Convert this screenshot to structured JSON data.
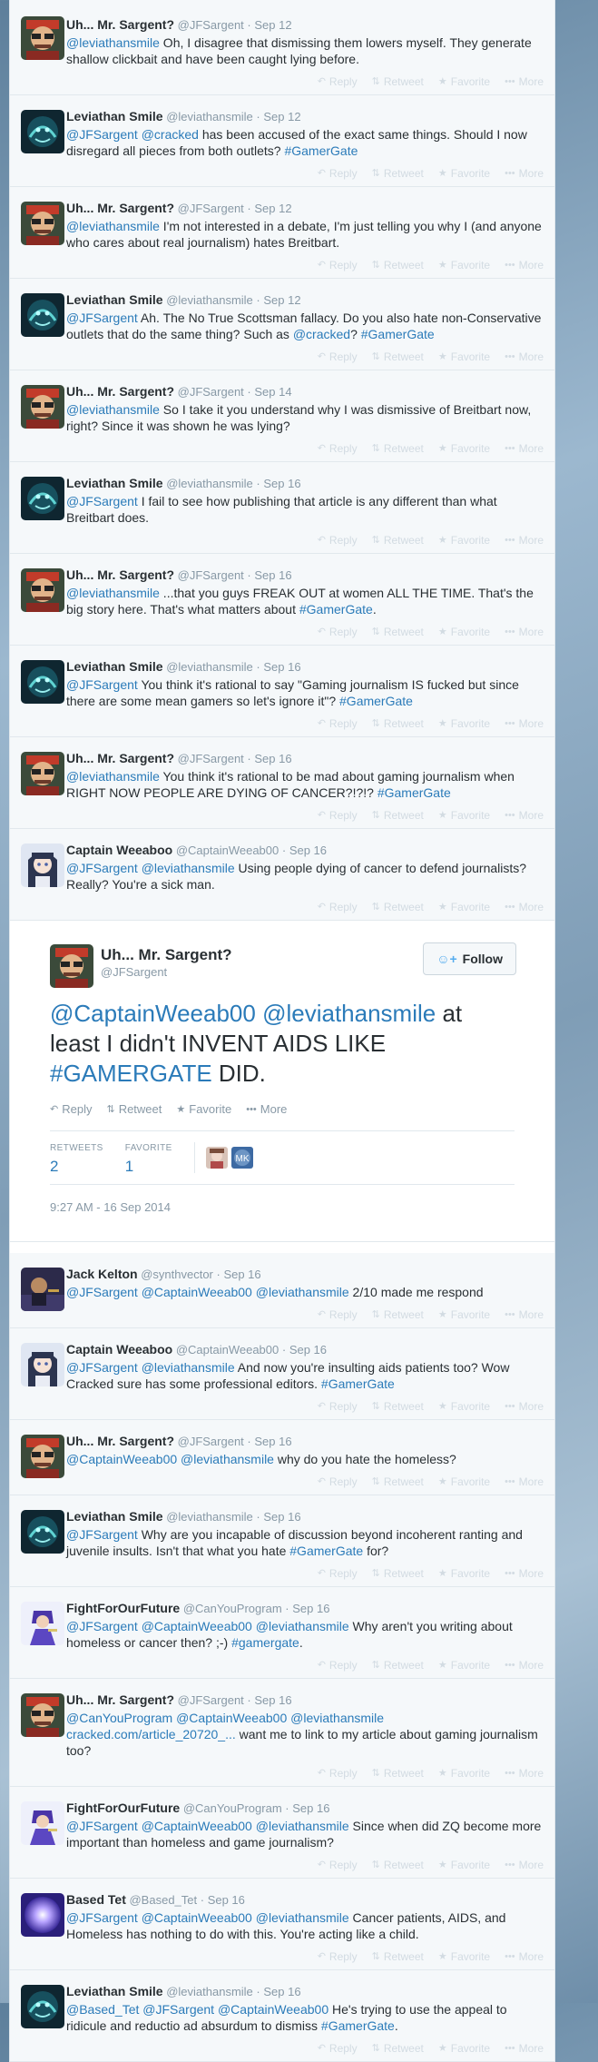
{
  "tweets_before": [
    {
      "name": "Uh... Mr. Sargent?",
      "handle": "@JFSargent",
      "time": "Sep 12",
      "avatar": "sargent",
      "segments": [
        [
          "a",
          "@leviathansmile"
        ],
        [
          "t",
          " Oh, I disagree that dismissing them lowers myself. They generate shallow clickbait and have been caught lying before."
        ]
      ]
    },
    {
      "name": "Leviathan Smile",
      "handle": "@leviathansmile",
      "time": "Sep 12",
      "avatar": "leviathan",
      "segments": [
        [
          "a",
          "@JFSargent"
        ],
        [
          "t",
          " "
        ],
        [
          "a",
          "@cracked"
        ],
        [
          "t",
          " has been accused of the exact same things. Should I now disregard all pieces from both outlets? "
        ],
        [
          "g",
          "#GamerGate"
        ]
      ]
    },
    {
      "name": "Uh... Mr. Sargent?",
      "handle": "@JFSargent",
      "time": "Sep 12",
      "avatar": "sargent",
      "segments": [
        [
          "a",
          "@leviathansmile"
        ],
        [
          "t",
          " I'm not interested in a debate, I'm just telling you why I (and anyone who cares about real journalism) hates Breitbart."
        ]
      ]
    },
    {
      "name": "Leviathan Smile",
      "handle": "@leviathansmile",
      "time": "Sep 12",
      "avatar": "leviathan",
      "segments": [
        [
          "a",
          "@JFSargent"
        ],
        [
          "t",
          " Ah. The No True Scottsman fallacy. Do you also hate non-Conservative outlets that do the same thing? Such as "
        ],
        [
          "a",
          "@cracked"
        ],
        [
          "t",
          "? "
        ],
        [
          "g",
          "#GamerGate"
        ]
      ]
    },
    {
      "name": "Uh... Mr. Sargent?",
      "handle": "@JFSargent",
      "time": "Sep 14",
      "avatar": "sargent",
      "segments": [
        [
          "a",
          "@leviathansmile"
        ],
        [
          "t",
          " So I take it you understand why I was dismissive of Breitbart now, right? Since it was shown he was lying?"
        ]
      ]
    },
    {
      "name": "Leviathan Smile",
      "handle": "@leviathansmile",
      "time": "Sep 16",
      "avatar": "leviathan",
      "segments": [
        [
          "a",
          "@JFSargent"
        ],
        [
          "t",
          " I fail to see how publishing that article is any different than what Breitbart does."
        ]
      ]
    },
    {
      "name": "Uh... Mr. Sargent?",
      "handle": "@JFSargent",
      "time": "Sep 16",
      "avatar": "sargent",
      "segments": [
        [
          "a",
          "@leviathansmile"
        ],
        [
          "t",
          " ...that you guys FREAK OUT at women ALL THE TIME. That's the big story here. That's what matters about "
        ],
        [
          "g",
          "#GamerGate"
        ],
        [
          "t",
          "."
        ]
      ]
    },
    {
      "name": "Leviathan Smile",
      "handle": "@leviathansmile",
      "time": "Sep 16",
      "avatar": "leviathan",
      "segments": [
        [
          "a",
          "@JFSargent"
        ],
        [
          "t",
          " You think it's rational to say \"Gaming journalism IS fucked but since there are some mean gamers so let's ignore it\"? "
        ],
        [
          "g",
          "#GamerGate"
        ]
      ]
    },
    {
      "name": "Uh... Mr. Sargent?",
      "handle": "@JFSargent",
      "time": "Sep 16",
      "avatar": "sargent",
      "segments": [
        [
          "a",
          "@leviathansmile"
        ],
        [
          "t",
          " You think it's rational to be mad about gaming journalism when RIGHT NOW PEOPLE ARE DYING OF CANCER?!?!? "
        ],
        [
          "g",
          "#GamerGate"
        ]
      ]
    },
    {
      "name": "Captain Weeaboo",
      "handle": "@CaptainWeeab00",
      "time": "Sep 16",
      "avatar": "weeaboo",
      "segments": [
        [
          "a",
          "@JFSargent"
        ],
        [
          "t",
          " "
        ],
        [
          "a",
          "@leviathansmile"
        ],
        [
          "t",
          " Using people dying of cancer to defend journalists? Really? You're a sick man."
        ]
      ]
    }
  ],
  "actions": {
    "reply": "Reply",
    "retweet": "Retweet",
    "favorite": "Favorite",
    "more": "More"
  },
  "main": {
    "name": "Uh... Mr. Sargent?",
    "handle": "@JFSargent",
    "follow": "Follow",
    "segments": [
      [
        "a",
        "@CaptainWeeab00"
      ],
      [
        "t",
        " "
      ],
      [
        "a",
        "@leviathansmile"
      ],
      [
        "t",
        " at least I didn't INVENT AIDS LIKE "
      ],
      [
        "g",
        "#GAMERGATE"
      ],
      [
        "t",
        " DID."
      ]
    ],
    "retweets_label": "RETWEETS",
    "retweets": "2",
    "favorites_label": "FAVORITE",
    "favorites": "1",
    "timestamp": "9:27 AM - 16 Sep 2014"
  },
  "tweets_after": [
    {
      "name": "Jack Kelton",
      "handle": "@synthvector",
      "time": "Sep 16",
      "avatar": "jack",
      "segments": [
        [
          "a",
          "@JFSargent"
        ],
        [
          "t",
          " "
        ],
        [
          "a",
          "@CaptainWeeab00"
        ],
        [
          "t",
          " "
        ],
        [
          "a",
          "@leviathansmile"
        ],
        [
          "t",
          " 2/10 made me respond"
        ]
      ]
    },
    {
      "name": "Captain Weeaboo",
      "handle": "@CaptainWeeab00",
      "time": "Sep 16",
      "avatar": "weeaboo",
      "segments": [
        [
          "a",
          "@JFSargent"
        ],
        [
          "t",
          " "
        ],
        [
          "a",
          "@leviathansmile"
        ],
        [
          "t",
          " And now you're insulting aids patients too? Wow Cracked sure has some professional editors. "
        ],
        [
          "g",
          "#GamerGate"
        ]
      ]
    },
    {
      "name": "Uh... Mr. Sargent?",
      "handle": "@JFSargent",
      "time": "Sep 16",
      "avatar": "sargent",
      "segments": [
        [
          "a",
          "@CaptainWeeab00"
        ],
        [
          "t",
          " "
        ],
        [
          "a",
          "@leviathansmile"
        ],
        [
          "t",
          " why do you hate the homeless?"
        ]
      ]
    },
    {
      "name": "Leviathan Smile",
      "handle": "@leviathansmile",
      "time": "Sep 16",
      "avatar": "leviathan",
      "segments": [
        [
          "a",
          "@JFSargent"
        ],
        [
          "t",
          " Why are you incapable of discussion beyond incoherent ranting and juvenile insults. Isn't that what you hate "
        ],
        [
          "g",
          "#GamerGate"
        ],
        [
          "t",
          " for?"
        ]
      ]
    },
    {
      "name": "FightForOurFuture",
      "handle": "@CanYouProgram",
      "time": "Sep 16",
      "avatar": "fight",
      "segments": [
        [
          "a",
          "@JFSargent"
        ],
        [
          "t",
          " "
        ],
        [
          "a",
          "@CaptainWeeab00"
        ],
        [
          "t",
          " "
        ],
        [
          "a",
          "@leviathansmile"
        ],
        [
          "t",
          " Why aren't you writing about homeless or cancer then? ;-) "
        ],
        [
          "g",
          "#gamergate"
        ],
        [
          "t",
          "."
        ]
      ]
    },
    {
      "name": "Uh... Mr. Sargent?",
      "handle": "@JFSargent",
      "time": "Sep 16",
      "avatar": "sargent",
      "segments": [
        [
          "a",
          "@CanYouProgram"
        ],
        [
          "t",
          " "
        ],
        [
          "a",
          "@CaptainWeeab00"
        ],
        [
          "t",
          " "
        ],
        [
          "a",
          "@leviathansmile"
        ],
        [
          "t",
          " "
        ],
        [
          "a",
          "cracked.com/article_20720_..."
        ],
        [
          "t",
          " want me to link to my article about gaming journalism too?"
        ]
      ]
    },
    {
      "name": "FightForOurFuture",
      "handle": "@CanYouProgram",
      "time": "Sep 16",
      "avatar": "fight",
      "segments": [
        [
          "a",
          "@JFSargent"
        ],
        [
          "t",
          " "
        ],
        [
          "a",
          "@CaptainWeeab00"
        ],
        [
          "t",
          " "
        ],
        [
          "a",
          "@leviathansmile"
        ],
        [
          "t",
          " Since when did ZQ become more important than homeless and game journalism?"
        ]
      ]
    },
    {
      "name": "Based Tet",
      "handle": "@Based_Tet",
      "time": "Sep 16",
      "avatar": "tet",
      "segments": [
        [
          "a",
          "@JFSargent"
        ],
        [
          "t",
          " "
        ],
        [
          "a",
          "@CaptainWeeab00"
        ],
        [
          "t",
          " "
        ],
        [
          "a",
          "@leviathansmile"
        ],
        [
          "t",
          " Cancer patients, AIDS, and Homeless has nothing to do with this. You're acting like a child."
        ]
      ]
    },
    {
      "name": "Leviathan Smile",
      "handle": "@leviathansmile",
      "time": "Sep 16",
      "avatar": "leviathan",
      "segments": [
        [
          "a",
          "@Based_Tet"
        ],
        [
          "t",
          " "
        ],
        [
          "a",
          "@JFSargent"
        ],
        [
          "t",
          " "
        ],
        [
          "a",
          "@CaptainWeeab00"
        ],
        [
          "t",
          " He's trying to use the appeal to ridicule and reductio ad absurdum to dismiss "
        ],
        [
          "g",
          "#GamerGate"
        ],
        [
          "t",
          "."
        ]
      ]
    }
  ],
  "colors": {
    "link": "#2b7bb9",
    "muted": "#8899a6",
    "action_faded": "#d2dbe2",
    "panel": "#f5f8fa",
    "border": "#e1e8ed"
  }
}
